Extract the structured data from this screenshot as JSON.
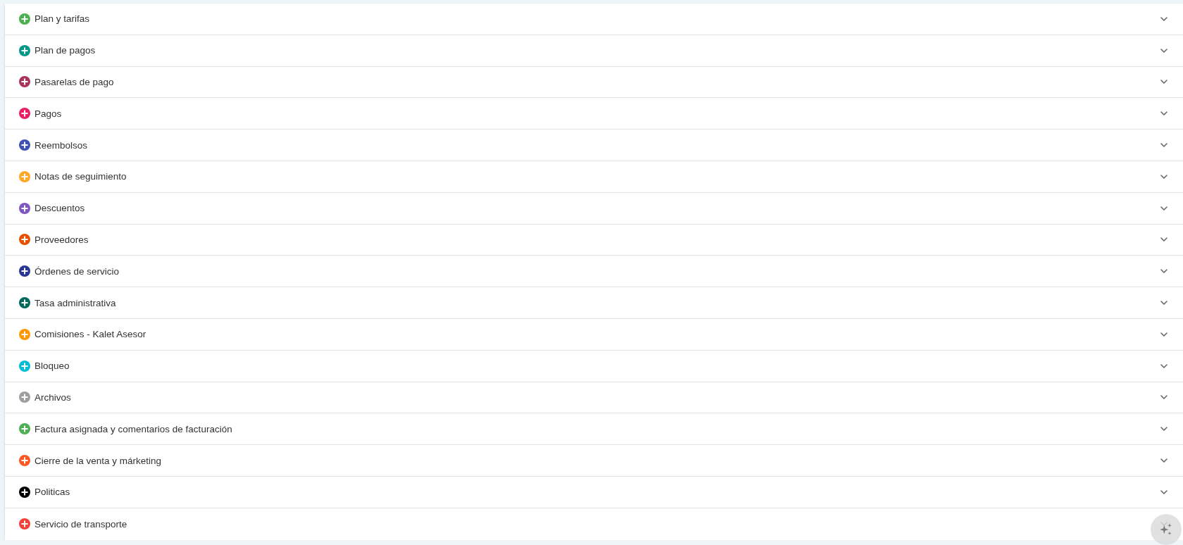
{
  "sections": [
    {
      "title": "Plan y tarifas",
      "color": "#4caf50",
      "expanded": false
    },
    {
      "title": "Plan de pagos",
      "color": "#009688",
      "expanded": false
    },
    {
      "title": "Pasarelas de pago",
      "color": "#a8365a",
      "expanded": false
    },
    {
      "title": "Pagos",
      "color": "#e91e63",
      "expanded": false
    },
    {
      "title": "Reembolsos",
      "color": "#3f51b5",
      "expanded": false
    },
    {
      "title": "Notas de seguimiento",
      "color": "#ffa726",
      "expanded": false
    },
    {
      "title": "Descuentos",
      "color": "#7e57c2",
      "expanded": false
    },
    {
      "title": "Proveedores",
      "color": "#e65100",
      "expanded": false
    },
    {
      "title": "Órdenes de servicio",
      "color": "#283593",
      "expanded": false
    },
    {
      "title": "Tasa administrativa",
      "color": "#00695c",
      "expanded": false
    },
    {
      "title": "Comisiones - Kalet Asesor",
      "color": "#ff9800",
      "expanded": false
    },
    {
      "title": "Bloqueo",
      "color": "#00bcd4",
      "expanded": false
    },
    {
      "title": "Archivos",
      "color": "#9e9e9e",
      "expanded": false
    },
    {
      "title": "Factura asignada y comentarios de facturación",
      "color": "#4caf50",
      "expanded": false
    },
    {
      "title": "Cierre de la venta y márketing",
      "color": "#ff5722",
      "expanded": false
    },
    {
      "title": "Politicas",
      "color": "#000000",
      "expanded": false
    },
    {
      "title": "Servicio de transporte",
      "color": "#f44336",
      "expanded": false
    }
  ]
}
